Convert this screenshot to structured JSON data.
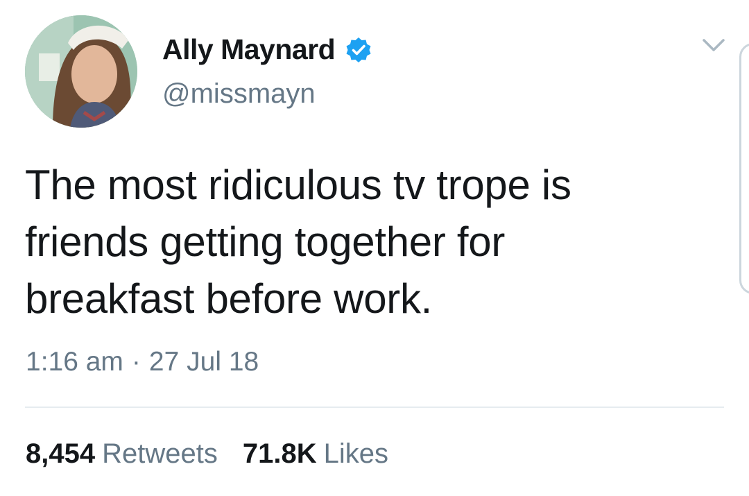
{
  "user": {
    "display_name": "Ally Maynard",
    "handle": "@missmayn",
    "verified": true,
    "verified_color": "#1da1f2",
    "avatar_icon": "profile-photo"
  },
  "tweet": {
    "text": "The most ridiculous tv trope is friends getting together for breakfast before work.",
    "time": "1:16 am",
    "separator": "·",
    "date": "27 Jul 18"
  },
  "stats": {
    "retweets_count": "8,454",
    "retweets_label": "Retweets",
    "likes_count": "71.8K",
    "likes_label": "Likes"
  },
  "icons": {
    "menu": "chevron-down-icon",
    "verified": "verified-badge-icon"
  }
}
